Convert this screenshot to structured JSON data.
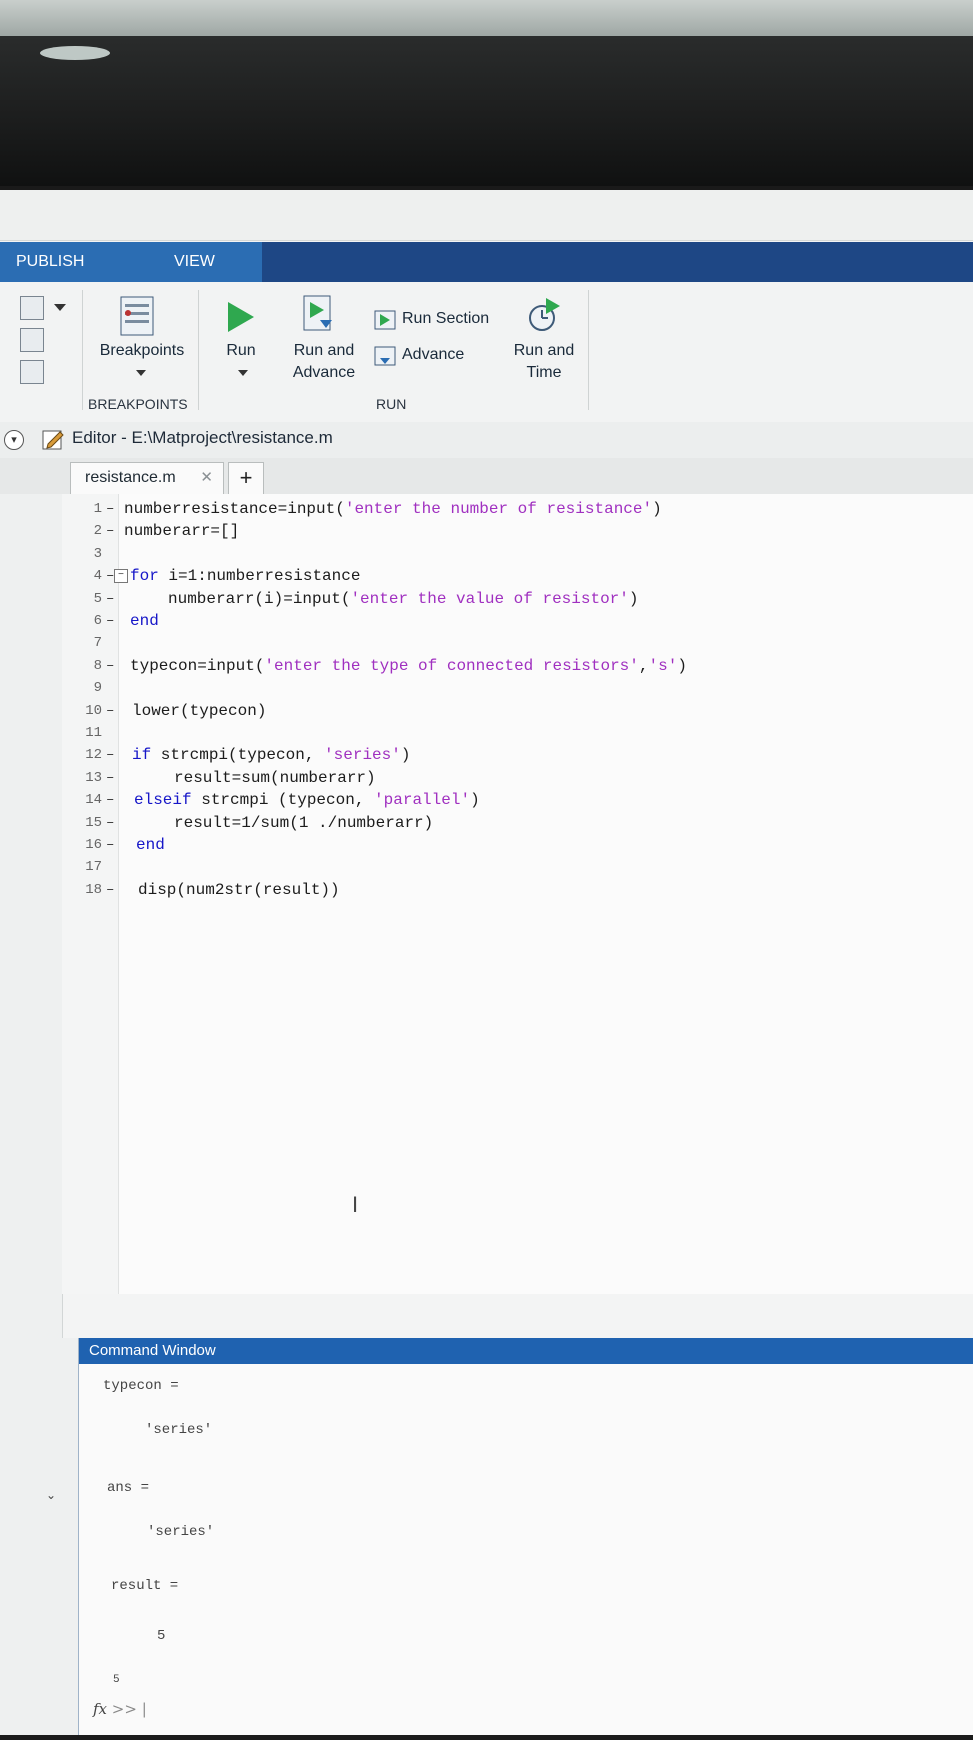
{
  "toolstrip": {
    "tabs": [
      "PUBLISH",
      "VIEW"
    ]
  },
  "ribbon": {
    "breakpoints_label": "Breakpoints",
    "run_label": "Run",
    "run_and_advance_line1": "Run and",
    "run_and_advance_line2": "Advance",
    "run_section_label": "Run Section",
    "advance_label": "Advance",
    "run_and_time_line1": "Run and",
    "run_and_time_line2": "Time",
    "group_breakpoints": "BREAKPOINTS",
    "group_run": "RUN"
  },
  "editor": {
    "title": "Editor - E:\\Matproject\\resistance.m",
    "file_tab": "resistance.m",
    "close_glyph": "✕",
    "add_tab": "+"
  },
  "code_lines": [
    {
      "n": "1",
      "dash": "–",
      "text": "numberresistance=input('enter the number of resistance')"
    },
    {
      "n": "2",
      "dash": "–",
      "text": "numberarr=[]"
    },
    {
      "n": "3",
      "dash": "",
      "text": ""
    },
    {
      "n": "4",
      "dash": "–",
      "text": "for i=1:numberresistance"
    },
    {
      "n": "5",
      "dash": "–",
      "text": "numberarr(i)=input('enter the value of resistor')"
    },
    {
      "n": "6",
      "dash": "–",
      "text": "end"
    },
    {
      "n": "7",
      "dash": "",
      "text": ""
    },
    {
      "n": "8",
      "dash": "–",
      "text": "typecon=input('enter the type of connected resistors','s')"
    },
    {
      "n": "9",
      "dash": "",
      "text": ""
    },
    {
      "n": "10",
      "dash": "–",
      "text": "lower(typecon)"
    },
    {
      "n": "11",
      "dash": "",
      "text": ""
    },
    {
      "n": "12",
      "dash": "–",
      "text": "if strcmpi(typecon, 'series')"
    },
    {
      "n": "13",
      "dash": "–",
      "text": "result=sum(numberarr)"
    },
    {
      "n": "14",
      "dash": "–",
      "text": "elseif strcmpi (typecon, 'parallel')"
    },
    {
      "n": "15",
      "dash": "–",
      "text": "result=1/sum(1 ./numberarr)"
    },
    {
      "n": "16",
      "dash": "–",
      "text": "end"
    },
    {
      "n": "17",
      "dash": "",
      "text": ""
    },
    {
      "n": "18",
      "dash": "–",
      "text": "disp(num2str(result))"
    }
  ],
  "command_window": {
    "title": "Command Window",
    "lines": [
      "typecon =",
      "'series'",
      "ans =",
      "'series'",
      "result =",
      "5",
      "5"
    ],
    "prompt": "fx"
  }
}
